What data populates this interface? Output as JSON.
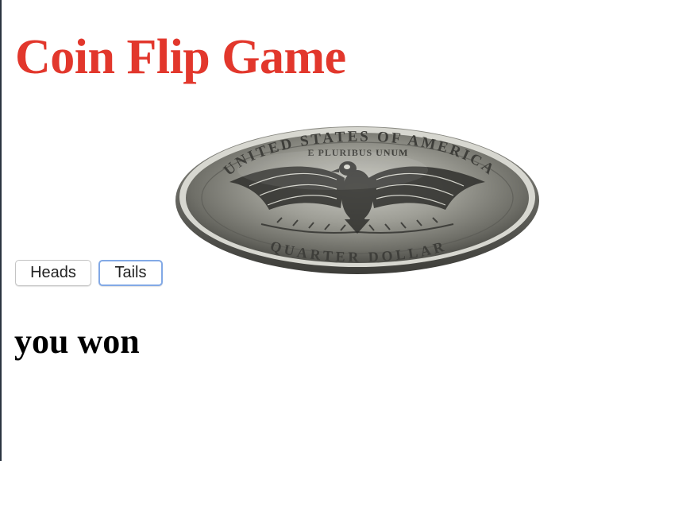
{
  "page": {
    "title": "Coin Flip Game",
    "title_color": "#e2372c"
  },
  "coin": {
    "icon": "quarter-coin-tails-eagle-icon",
    "inscriptions": {
      "top_arc": "UNITED STATES OF AMERICA",
      "motto": "E PLURIBUS UNUM",
      "bottom_arc": "QUARTER DOLLAR"
    }
  },
  "controls": {
    "heads_label": "Heads",
    "tails_label": "Tails",
    "focused": "Tails",
    "focus_color": "#82a9e6"
  },
  "result": {
    "message": "you won"
  }
}
